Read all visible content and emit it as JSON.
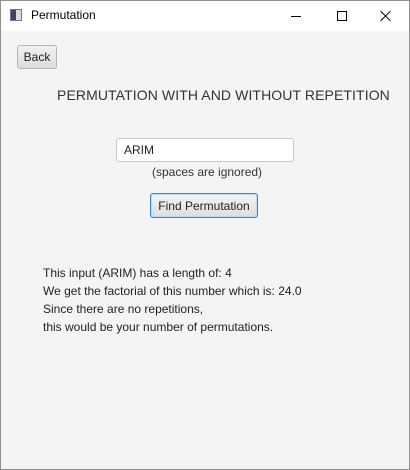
{
  "window": {
    "title": "Permutation",
    "controls": {
      "minimize": "minimize-icon",
      "maximize": "maximize-icon",
      "close": "close-icon"
    }
  },
  "toolbar": {
    "back_label": "Back"
  },
  "main": {
    "title": "PERMUTATION WITH AND WITHOUT REPETITION",
    "input": {
      "value": "ARIM",
      "placeholder": ""
    },
    "hint": "(spaces are ignored)",
    "find_button_label": "Find Permutation",
    "result_lines": [
      "This input (ARIM) has a length of: 4",
      "We get the factorial of this number which is: 24.0",
      "Since there are no repetitions,",
      "this would be your number of permutations."
    ]
  },
  "colors": {
    "background": "#f4f4f4",
    "focus_border": "#2f8bd6"
  }
}
